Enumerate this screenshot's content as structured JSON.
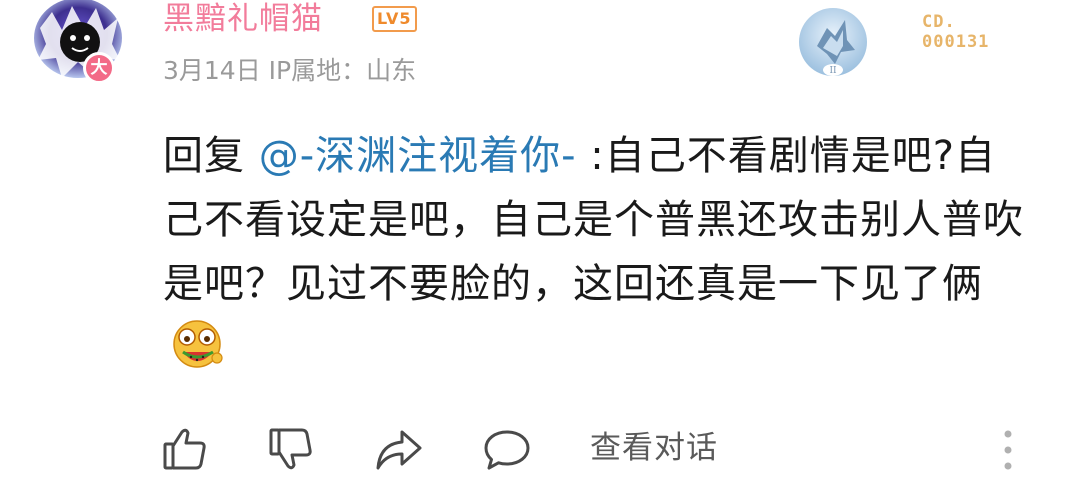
{
  "comment": {
    "user": {
      "name": "黑黯礼帽猫",
      "level_badge": "LV5",
      "avatar_badge": "大"
    },
    "meta": "3月14日 IP属地：山东",
    "fan_badge": {
      "label": "CD.",
      "number": "000131"
    },
    "content": {
      "prefix": "回复 ",
      "mention": "@-深渊注视着你-",
      "text": " :自己不看剧情是吧?自己不看设定是吧，自己是个普黑还攻击别人普吹是吧？见过不要脸的，这回还真是一下见了俩",
      "emoji": "laughing-eating-watermelon-emoji"
    },
    "actions": {
      "view_dialog": "查看对话",
      "icons": [
        "thumbs-up-icon",
        "thumbs-down-icon",
        "share-icon",
        "comment-icon",
        "more-icon"
      ]
    }
  },
  "colors": {
    "username": "#f27c9b",
    "mention": "#2a7ab4",
    "level": "#ef8a2c",
    "fan_badge": "#e7b56a"
  }
}
